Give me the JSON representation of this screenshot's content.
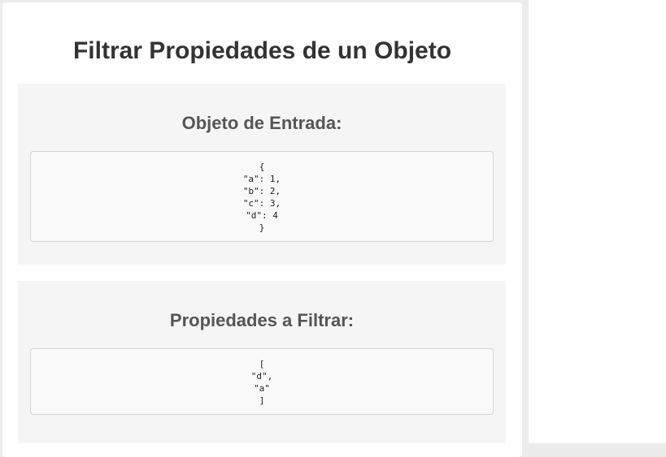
{
  "page": {
    "title": "Filtrar Propiedades de un Objeto"
  },
  "input_section": {
    "title": "Objeto de Entrada:",
    "code": "{\n\"a\": 1,\n\"b\": 2,\n\"c\": 3,\n\"d\": 4\n}"
  },
  "filter_section": {
    "title": "Propiedades a Filtrar:",
    "code": "[\n\"d\",\n\"a\"\n]"
  },
  "colors": {
    "background": "#ececec",
    "card": "#ffffff",
    "section_bg": "#f5f5f5",
    "title_text": "#333333",
    "section_title_text": "#555555"
  }
}
